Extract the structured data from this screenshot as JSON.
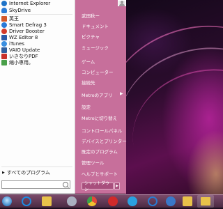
{
  "left_pane": {
    "programs": [
      {
        "label": "Internet Explorer",
        "icon": "internet-explorer-icon",
        "color": "#1e73c8"
      },
      {
        "label": "SkyDrive",
        "icon": "skydrive-icon",
        "color": "#2b7bd6"
      },
      {
        "label": "",
        "icon": "separator",
        "color": ""
      },
      {
        "label": "英王",
        "icon": "eiou-app-icon",
        "color": "#d4582a"
      },
      {
        "label": "Smart Defrag 3",
        "icon": "smart-defrag-icon",
        "color": "#2a7ad8"
      },
      {
        "label": "Driver Booster",
        "icon": "driver-booster-icon",
        "color": "#d43a2a"
      },
      {
        "label": "WZ Editor 8",
        "icon": "wz-editor-icon",
        "color": "#2c5aa8"
      },
      {
        "label": "iTunes",
        "icon": "itunes-icon",
        "color": "#3a8fe0"
      },
      {
        "label": "VAIO Update",
        "icon": "vaio-update-icon",
        "color": "#2f5f9f"
      },
      {
        "label": "いきなりPDF",
        "icon": "ikinari-pdf-icon",
        "color": "#c8302a"
      },
      {
        "label": "縮小専用。",
        "icon": "shukusho-senyou-icon",
        "color": "#4aa04a"
      }
    ],
    "all_programs_label": "すべてのプログラム",
    "search_placeholder": ""
  },
  "right_pane": {
    "items": [
      {
        "label": "武田秋ー",
        "name": "user-name"
      },
      {
        "label": "ドキュメント",
        "name": "documents"
      },
      {
        "label": "ピクチャ",
        "name": "pictures"
      },
      {
        "label": "ミュージック",
        "name": "music"
      },
      {
        "label": "ゲーム",
        "name": "games"
      },
      {
        "label": "コンピューター",
        "name": "computer"
      },
      {
        "label": "接続先",
        "name": "connect-to"
      },
      {
        "label": "Metroのアプリ",
        "name": "metro-apps",
        "submenu": "▶"
      },
      {
        "label": "設定",
        "name": "settings"
      },
      {
        "label": "Metroに切り替え",
        "name": "switch-to-metro"
      },
      {
        "label": "コントロールパネル",
        "name": "control-panel"
      },
      {
        "label": "デバイスとプリンター",
        "name": "devices-and-printers"
      },
      {
        "label": "既定のプログラム",
        "name": "default-programs"
      },
      {
        "label": "管理ツール",
        "name": "admin-tools"
      },
      {
        "label": "ヘルプとサポート",
        "name": "help-and-support"
      }
    ],
    "shutdown_label": "シャットダウン",
    "shutdown_chevron": "▶"
  },
  "taskbar": {
    "buttons": [
      {
        "icon": "start-orb-icon",
        "color": "#6fb6e8"
      },
      {
        "icon": "internet-explorer-icon",
        "color": "#1e8ae0"
      },
      {
        "icon": "file-explorer-icon",
        "color": "#e8c24a"
      },
      {
        "icon": "system-tool-icon",
        "color": "#aab0c0"
      },
      {
        "icon": "chrome-icon",
        "color": "#e04a3a"
      },
      {
        "icon": "red-app-icon",
        "color": "#d02a2a"
      },
      {
        "icon": "blue-app-icon",
        "color": "#2aa0e0"
      },
      {
        "icon": "c-app-icon",
        "color": "#2a7ad0"
      },
      {
        "icon": "settings-app-icon",
        "color": "#3a78c8"
      },
      {
        "icon": "folder-icon",
        "color": "#e8c24a"
      },
      {
        "icon": "folder-active-icon",
        "color": "#e8c24a"
      }
    ]
  },
  "colors": {
    "start_menu_right": "#c76f9b",
    "start_menu_left": "#fdfdfd",
    "taskbar": "#5a3350"
  }
}
